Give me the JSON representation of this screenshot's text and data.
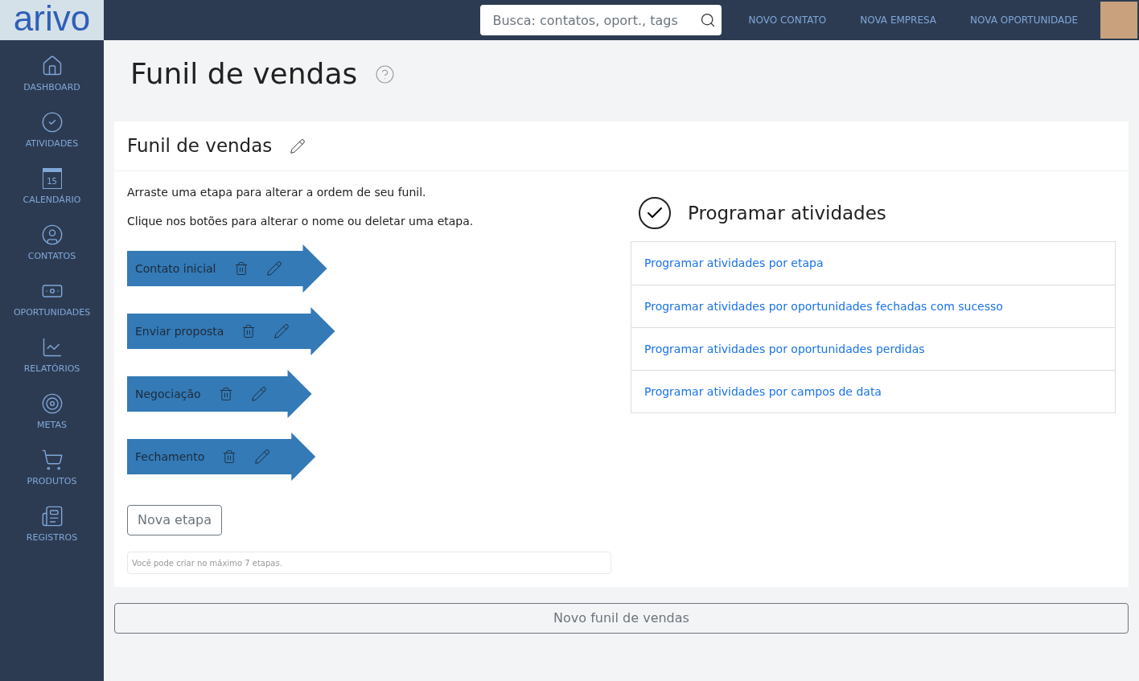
{
  "logo": "arivo",
  "search": {
    "placeholder": "Busca: contatos, oport., tags"
  },
  "top_links": [
    "NOVO CONTATO",
    "NOVA EMPRESA",
    "NOVA OPORTUNIDADE"
  ],
  "sidebar": {
    "items": [
      {
        "label": "DASHBOARD"
      },
      {
        "label": "ATIVIDADES"
      },
      {
        "label": "CALENDÁRIO",
        "icon_text": "15"
      },
      {
        "label": "CONTATOS"
      },
      {
        "label": "OPORTUNIDADES"
      },
      {
        "label": "RELATÓRIOS"
      },
      {
        "label": "METAS"
      },
      {
        "label": "PRODUTOS"
      },
      {
        "label": "REGISTROS"
      }
    ]
  },
  "page_title": "Funil de vendas",
  "card": {
    "title": "Funil de vendas",
    "instructions": [
      "Arraste uma etapa para alterar a ordem de seu funil.",
      "Clique nos botões para alterar o nome ou deletar uma etapa."
    ],
    "stages": [
      {
        "name": "Contato inicial"
      },
      {
        "name": "Enviar proposta"
      },
      {
        "name": "Negociação"
      },
      {
        "name": "Fechamento"
      }
    ],
    "new_stage_button": "Nova etapa",
    "note": "Você pode criar no máximo 7 etapas.",
    "schedule": {
      "title": "Programar atividades",
      "links": [
        "Programar atividades por etapa",
        "Programar atividades por oportunidades fechadas com sucesso",
        "Programar atividades por oportunidades perdidas",
        "Programar atividades por campos de data"
      ]
    }
  },
  "new_funnel_button": "Novo funil de vendas"
}
